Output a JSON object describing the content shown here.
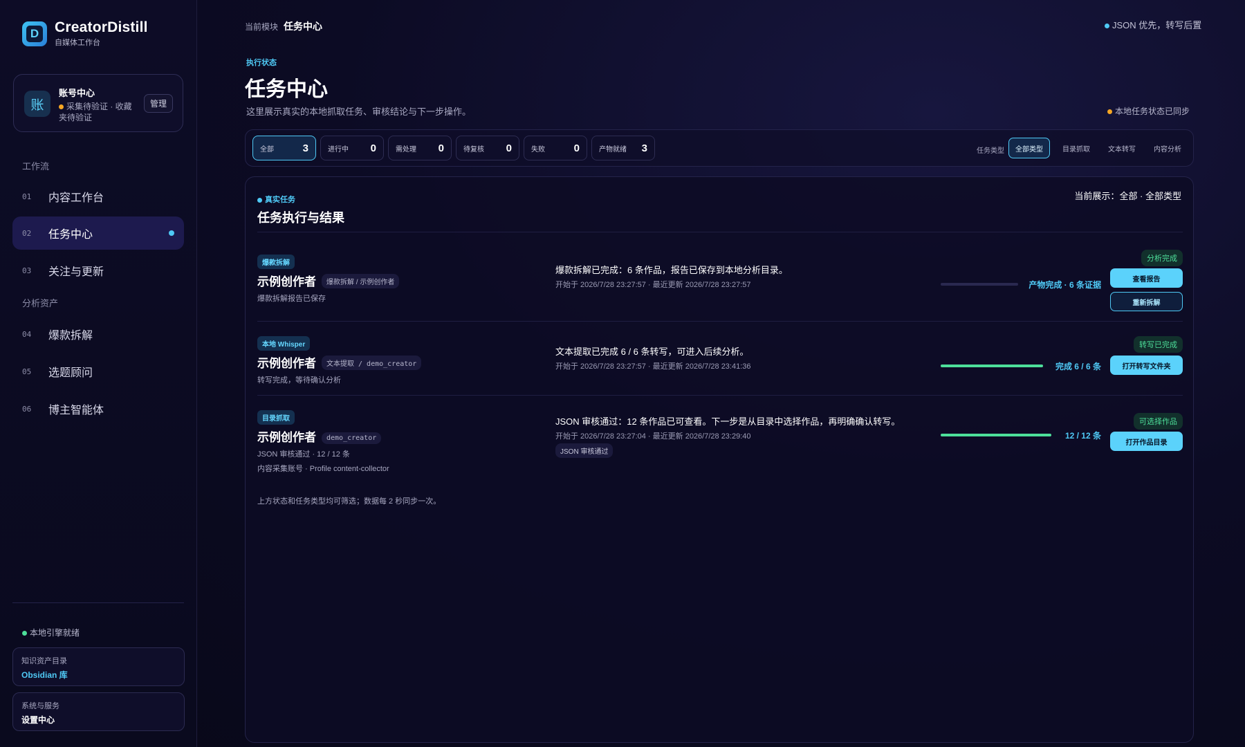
{
  "brand": {
    "name": "CreatorDistill",
    "subtitle": "自媒体工作台",
    "logo_letter": "D"
  },
  "account": {
    "avatar_text": "账",
    "title": "账号中心",
    "status": "采集待验证 · 收藏夹待验证",
    "status_color": "#f5a623",
    "manage_label": "管理"
  },
  "nav": {
    "workflow_label": "工作流",
    "assets_label": "分析资产",
    "items": [
      {
        "num": "01",
        "label": "内容工作台"
      },
      {
        "num": "02",
        "label": "任务中心",
        "active": true
      },
      {
        "num": "03",
        "label": "关注与更新"
      },
      {
        "num": "04",
        "label": "爆款拆解"
      },
      {
        "num": "05",
        "label": "选题顾问"
      },
      {
        "num": "06",
        "label": "博主智能体"
      }
    ]
  },
  "engine_status": "本地引擎就绪",
  "side_cards": [
    {
      "key": "知识资产目录",
      "value": "Obsidian 库",
      "value_color": "#4fc9f5"
    },
    {
      "key": "系统与服务",
      "value": "设置中心",
      "value_color": "#ffffff"
    }
  ],
  "header": {
    "crumb_label": "当前模块",
    "crumb_value": "任务中心",
    "top_right": "JSON 优先，转写后置",
    "exec_label": "执行状态",
    "title": "任务中心",
    "description": "这里展示真实的本地抓取任务、审核结论与下一步操作。",
    "sync_status": "本地任务状态已同步"
  },
  "status_filters": [
    {
      "label": "全部",
      "count": "3",
      "active": true
    },
    {
      "label": "进行中",
      "count": "0"
    },
    {
      "label": "需处理",
      "count": "0"
    },
    {
      "label": "待复核",
      "count": "0"
    },
    {
      "label": "失败",
      "count": "0"
    },
    {
      "label": "产物就绪",
      "count": "3"
    }
  ],
  "type_filter": {
    "label": "任务类型",
    "options": [
      {
        "label": "全部类型",
        "active": true
      },
      {
        "label": "目录抓取"
      },
      {
        "label": "文本转写"
      },
      {
        "label": "内容分析"
      }
    ]
  },
  "panel": {
    "kicker": "真实任务",
    "title": "任务执行与结果",
    "current_label": "当前展示：",
    "current_value": "全部 · 全部类型",
    "footnote": "上方状态和任务类型均可筛选；数据每 2 秒同步一次。"
  },
  "tasks": [
    {
      "tag": "爆款拆解",
      "creator": "示例创作者",
      "mini": "爆款拆解 / 示例创作者",
      "sub": [
        "爆款拆解报告已保存"
      ],
      "message": "爆款拆解已完成：6 条作品，报告已保存到本地分析目录。",
      "time": "开始于 2026/7/28 23:27:57 · 最近更新 2026/7/28 23:27:57",
      "progress": 0,
      "progress_text": "产物完成 · 6 条证据",
      "state": "分析完成",
      "buttons": [
        "查看报告",
        "重新拆解"
      ]
    },
    {
      "tag": "本地 Whisper",
      "creator": "示例创作者",
      "mini": "文本提取 / demo_creator",
      "sub": [
        "转写完成，等待确认分析"
      ],
      "message": "文本提取已完成 6 / 6 条转写，可进入后续分析。",
      "time": "开始于 2026/7/28 23:27:57 · 最近更新 2026/7/28 23:41:36",
      "progress": 1.0,
      "progress_text": "完成 6 / 6 条",
      "state": "转写已完成",
      "buttons": [
        "打开转写文件夹"
      ]
    },
    {
      "tag": "目录抓取",
      "creator": "示例创作者",
      "mini": "demo_creator",
      "sub": [
        "JSON 审核通过 · 12 / 12 条",
        "内容采集账号 · Profile content-collector"
      ],
      "message": "JSON 审核通过：12 条作品已可查看。下一步是从目录中选择作品，再明确确认转写。",
      "time": "开始于 2026/7/28 23:27:04 · 最近更新 2026/7/28 23:29:40",
      "badge": "JSON 审核通过",
      "progress": 1.0,
      "progress_text": "12 / 12 条",
      "state": "可选择作品",
      "buttons": [
        "打开作品目录"
      ]
    }
  ]
}
